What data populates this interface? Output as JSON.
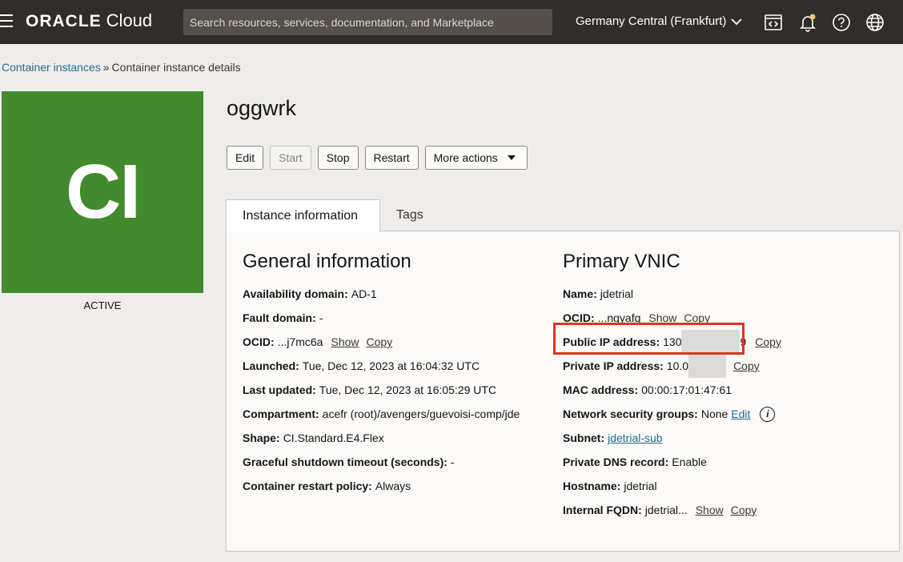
{
  "header": {
    "brand_oracle": "ORACLE",
    "brand_cloud": "Cloud",
    "search_placeholder": "Search resources, services, documentation, and Marketplace",
    "region": "Germany Central (Frankfurt)",
    "icons": [
      "menu-icon",
      "chevron-down-icon",
      "code-icon",
      "bell-icon",
      "help-icon",
      "globe-icon"
    ]
  },
  "breadcrumb": {
    "parent": "Container instances",
    "separator": "»",
    "current": "Container instance details"
  },
  "instance": {
    "badge": "CI",
    "badge_color": "#428a2e",
    "state": "ACTIVE",
    "name": "oggwrk"
  },
  "actions": {
    "edit": "Edit",
    "start": "Start",
    "stop": "Stop",
    "restart": "Restart",
    "more": "More actions"
  },
  "tabs": {
    "instance_info": "Instance information",
    "tags": "Tags"
  },
  "general": {
    "heading": "General information",
    "availability_domain": {
      "label": "Availability domain:",
      "value": "AD-1"
    },
    "fault_domain": {
      "label": "Fault domain:",
      "value": "-"
    },
    "ocid": {
      "label": "OCID:",
      "value": "...j7mc6a",
      "show": "Show",
      "copy": "Copy"
    },
    "launched": {
      "label": "Launched:",
      "value": "Tue, Dec 12, 2023 at 16:04:32 UTC"
    },
    "last_updated": {
      "label": "Last updated:",
      "value": "Tue, Dec 12, 2023 at 16:05:29 UTC"
    },
    "compartment": {
      "label": "Compartment:",
      "value": "acefr (root)/avengers/guevoisi-comp/jde"
    },
    "shape": {
      "label": "Shape:",
      "value": "CI.Standard.E4.Flex"
    },
    "graceful_shutdown": {
      "label": "Graceful shutdown timeout (seconds):",
      "value": "-"
    },
    "restart_policy": {
      "label": "Container restart policy:",
      "value": "Always"
    }
  },
  "vnic": {
    "heading": "Primary VNIC",
    "name": {
      "label": "Name:",
      "value": "jdetrial"
    },
    "ocid": {
      "label": "OCID:",
      "value": "...ngyafq",
      "show": "Show",
      "copy": "Copy"
    },
    "public_ip": {
      "label": "Public IP address:",
      "value_start": "130",
      "value_end": "9",
      "copy": "Copy"
    },
    "private_ip": {
      "label": "Private IP address:",
      "value_start": "10.0",
      "copy": "Copy"
    },
    "mac": {
      "label": "MAC address:",
      "value": "00:00:17:01:47:61"
    },
    "nsg": {
      "label": "Network security groups:",
      "value": "None",
      "edit": "Edit",
      "info": "i"
    },
    "subnet": {
      "label": "Subnet:",
      "value": "jdetrial-sub"
    },
    "dns": {
      "label": "Private DNS record:",
      "value": "Enable"
    },
    "hostname": {
      "label": "Hostname:",
      "value": "jdetrial"
    },
    "fqdn": {
      "label": "Internal FQDN:",
      "value": "jdetrial...",
      "show": "Show",
      "copy": "Copy"
    }
  },
  "highlight_color": "#e3321c"
}
